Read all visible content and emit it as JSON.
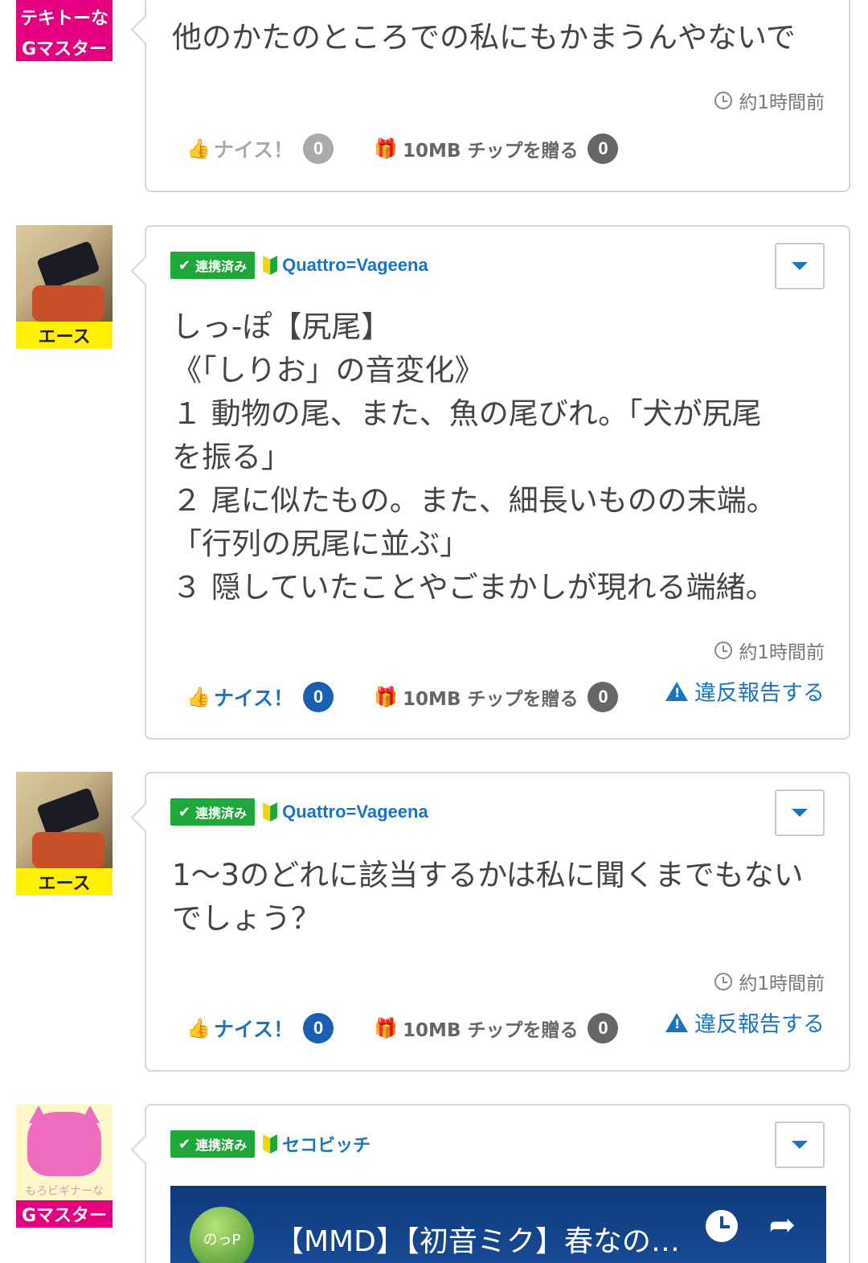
{
  "posts": [
    {
      "rank": "Gマスター",
      "avatar_caption": "テキトーな",
      "body": "他のかたのところでの私にもかまうんやないで",
      "time": "約1時間前",
      "nice_label": "ナイス！",
      "nice_count": "0",
      "tip_label": "10MB チップを贈る",
      "tip_count": "0"
    },
    {
      "rank": "エース",
      "linked_label": "連携済み",
      "user": "Quattro=Vageena",
      "body": "しっ‐ぽ【尻尾】\n《「しりお」の音変化》\n１ 動物の尾、また、魚の尾びれ。「犬が尻尾\nを振る」\n２ 尾に似たもの。また、細長いものの末端。\n「行列の尻尾に並ぶ」\n３ 隠していたことやごまかしが現れる端緒。",
      "time": "約1時間前",
      "nice_label": "ナイス！",
      "nice_count": "0",
      "tip_label": "10MB チップを贈る",
      "tip_count": "0",
      "report_label": "違反報告する"
    },
    {
      "rank": "エース",
      "linked_label": "連携済み",
      "user": "Quattro=Vageena",
      "body": "1〜3のどれに該当するかは私に聞くまでもない\nでしょう？",
      "time": "約1時間前",
      "nice_label": "ナイス！",
      "nice_count": "0",
      "tip_label": "10MB チップを贈る",
      "tip_count": "0",
      "report_label": "違反報告する"
    },
    {
      "rank": "Gマスター",
      "avatar_caption": "もろビギナーな",
      "linked_label": "連携済み",
      "user": "セコビッチ",
      "video_channel": "のっP",
      "video_title": "【MMD】【初音ミク】春なの…"
    }
  ]
}
